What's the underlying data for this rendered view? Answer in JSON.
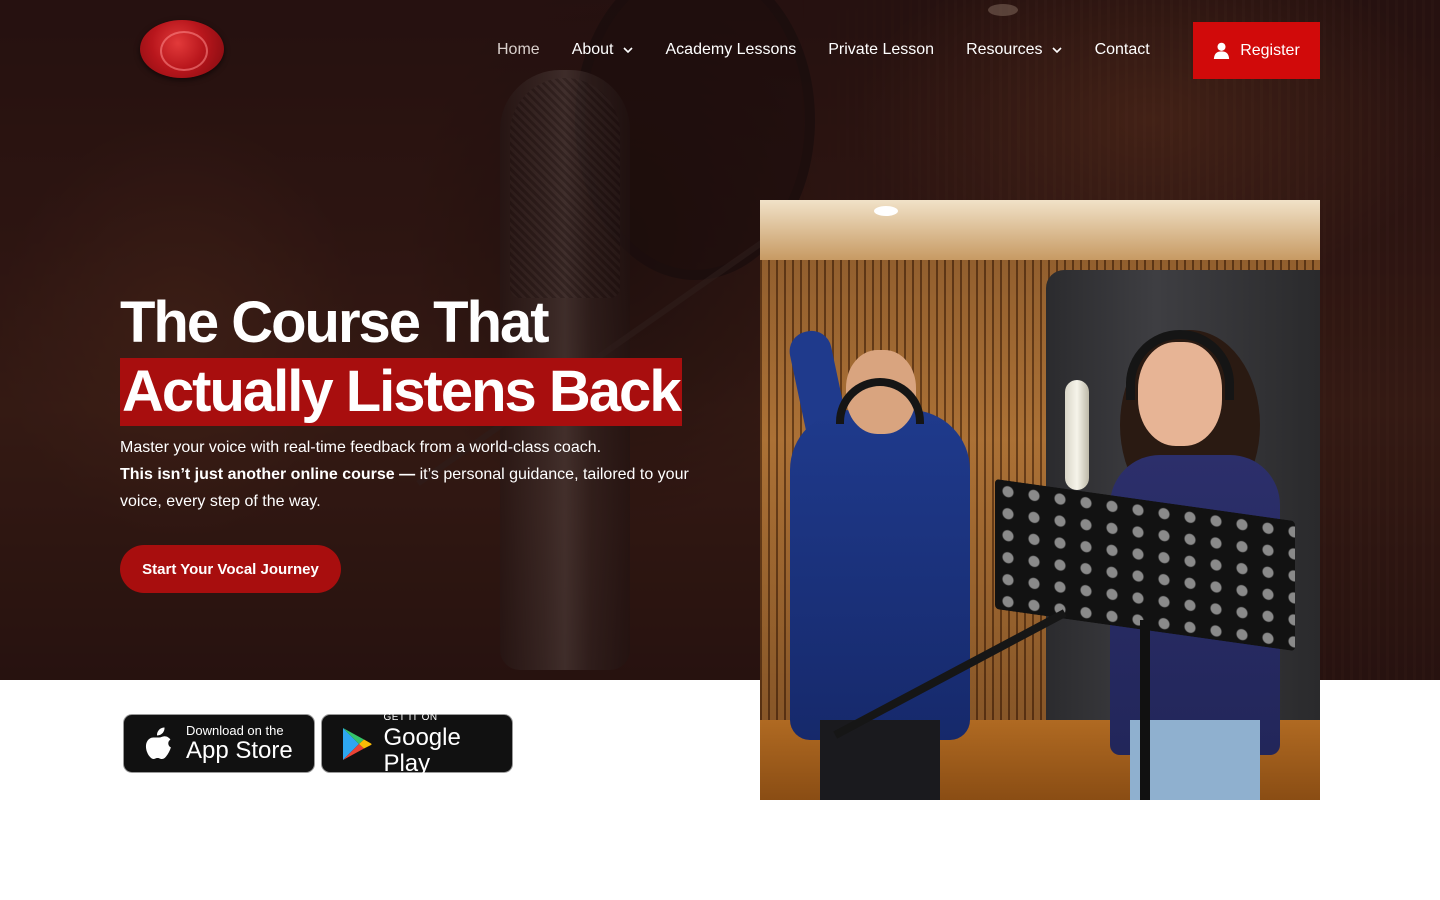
{
  "header": {
    "logo_name": "wax-seal-logo",
    "nav": [
      {
        "label": "Home",
        "active": true,
        "dropdown": false
      },
      {
        "label": "About",
        "active": false,
        "dropdown": true
      },
      {
        "label": "Academy Lessons",
        "active": false,
        "dropdown": false
      },
      {
        "label": "Private Lesson",
        "active": false,
        "dropdown": false
      },
      {
        "label": "Resources",
        "active": false,
        "dropdown": true
      },
      {
        "label": "Contact",
        "active": false,
        "dropdown": false
      }
    ],
    "register_label": "Register",
    "register_icon": "user-icon"
  },
  "hero": {
    "headline_line1": "The Course That",
    "headline_line2": "Actually Listens Back",
    "sub_line1": "Master your voice with real-time feedback from a world-class coach.",
    "sub_bold": "This isn’t just another online course —",
    "sub_rest": " it’s personal guidance, tailored to your voice, every step of the way.",
    "cta_label": "Start Your Vocal Journey"
  },
  "badges": {
    "apple": {
      "small": "Download on the",
      "big": "App Store",
      "icon": "apple-icon"
    },
    "google": {
      "small": "GET IT ON",
      "big": "Google Play",
      "icon": "google-play-icon"
    }
  },
  "colors": {
    "accent_red": "#d10a0a",
    "headline_highlight": "#a80e0e",
    "white": "#ffffff"
  }
}
